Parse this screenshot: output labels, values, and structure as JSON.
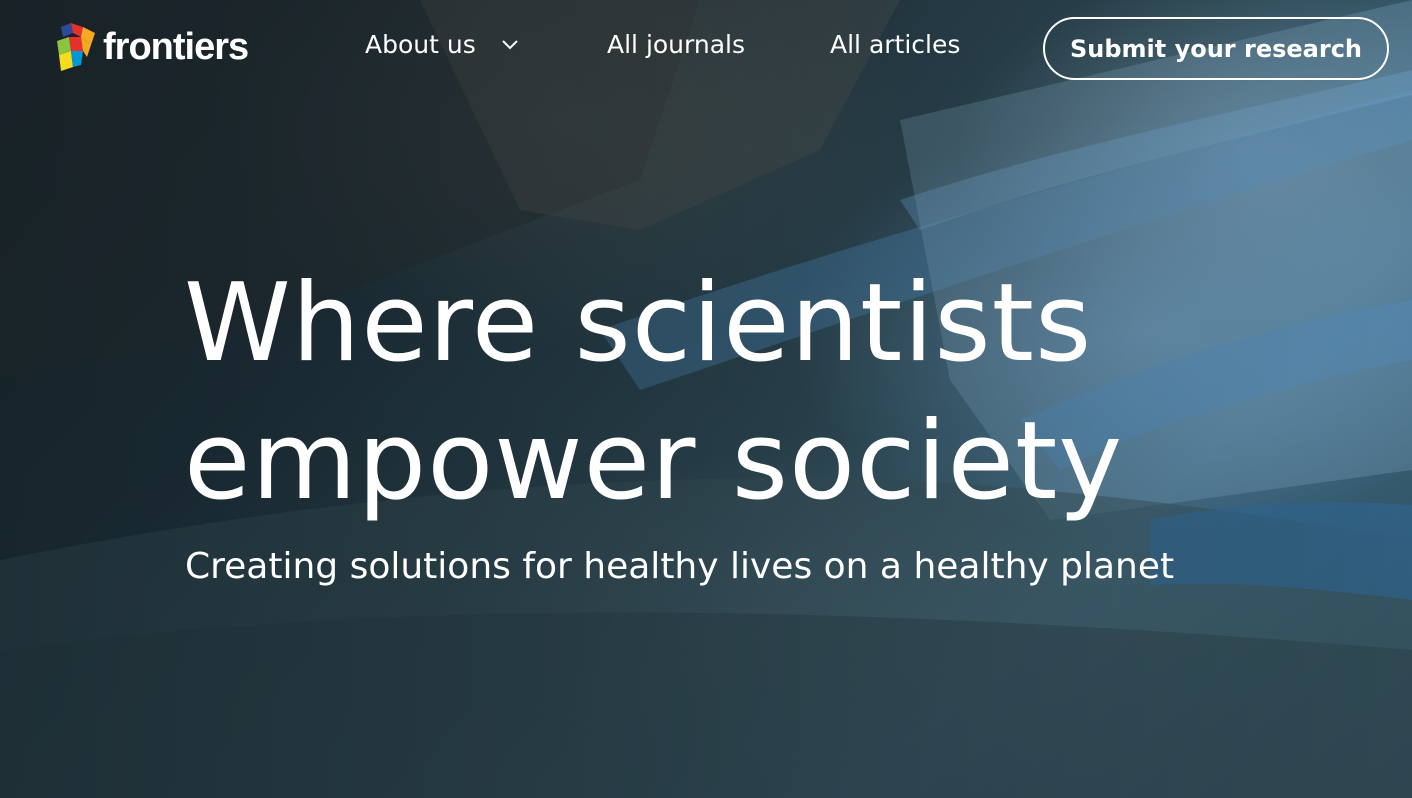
{
  "brand": {
    "name": "frontiers",
    "logo_colors": [
      "#e4312b",
      "#f7a823",
      "#0097d7",
      "#8bc53f",
      "#2b4a9b",
      "#f3dd1c"
    ]
  },
  "nav": {
    "items": [
      {
        "label": "About us",
        "has_dropdown": true
      },
      {
        "label": "All journals"
      },
      {
        "label": "All articles"
      }
    ],
    "cta_label": "Submit your research"
  },
  "hero": {
    "headline_line1": "Where scientists",
    "headline_line2": "empower society",
    "subheadline": "Creating solutions for healthy lives on a healthy planet",
    "background": "glacier-ice-cave-image"
  },
  "colors": {
    "text": "#ffffff",
    "overlay": "#1c2a30"
  }
}
